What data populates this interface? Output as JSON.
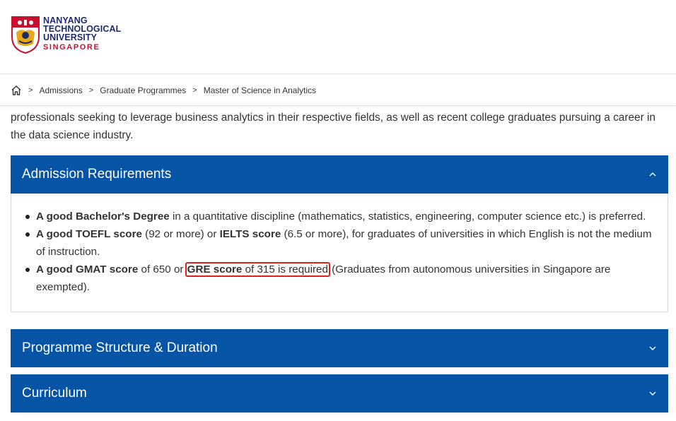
{
  "logo": {
    "line1": "NANYANG",
    "line2": "TECHNOLOGICAL",
    "line3": "UNIVERSITY",
    "line4": "SINGAPORE"
  },
  "breadcrumb": {
    "home_icon": "home-icon",
    "separator": ">",
    "items": [
      "Admissions",
      "Graduate Programmes",
      "Master of Science in Analytics"
    ]
  },
  "intro": {
    "text": "professionals seeking to leverage business analytics in their respective fields, as well as recent college graduates pursuing a career in the data science industry."
  },
  "sections": [
    {
      "title": "Admission Requirements",
      "expanded": true,
      "items": [
        {
          "bold": "A good Bachelor's Degree",
          "rest": " in a quantitative discipline (mathematics, statistics, engineering, computer science etc.) is preferred."
        },
        {
          "bold": "A good TOEFL score",
          "mid": " (92 or more) or ",
          "bold2": "IELTS score",
          "rest": " (6.5 or more), for graduates of universities in which English is not the medium of instruction."
        },
        {
          "bold": "A good GMAT score",
          "mid": " of 650 or ",
          "bold2": "GRE score",
          "hl_rest": " of 315 is required",
          "rest": " (Graduates from autonomous universities in Singapore are exempted)."
        }
      ]
    },
    {
      "title": "Programme Structure & Duration",
      "expanded": false
    },
    {
      "title": "Curriculum",
      "expanded": false
    }
  ],
  "colors": {
    "accordion_header": "#0554a5",
    "highlight_box": "#e0201b",
    "logo_blue": "#1f2a6b",
    "logo_red": "#c8102e"
  }
}
